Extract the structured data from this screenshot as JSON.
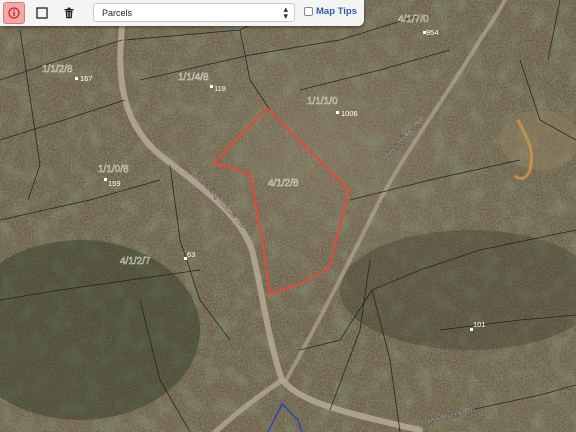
{
  "toolbar": {
    "info_icon": "info-circle-icon",
    "select_icon": "square-select-icon",
    "delete_icon": "trash-icon",
    "layer_select": {
      "value": "Parcels",
      "options": [
        "Parcels"
      ]
    },
    "map_tips": {
      "label": "Map Tips",
      "checked": false
    }
  },
  "map": {
    "selected_parcel_color": "#e24a3b",
    "parcel_numbers": [
      "954",
      "167",
      "118",
      "1006",
      "159",
      "63",
      "101"
    ],
    "road_labels": [
      "W Shaking Hollow Rd",
      "River Ridge Rd",
      "Moss Creek Rd"
    ]
  }
}
